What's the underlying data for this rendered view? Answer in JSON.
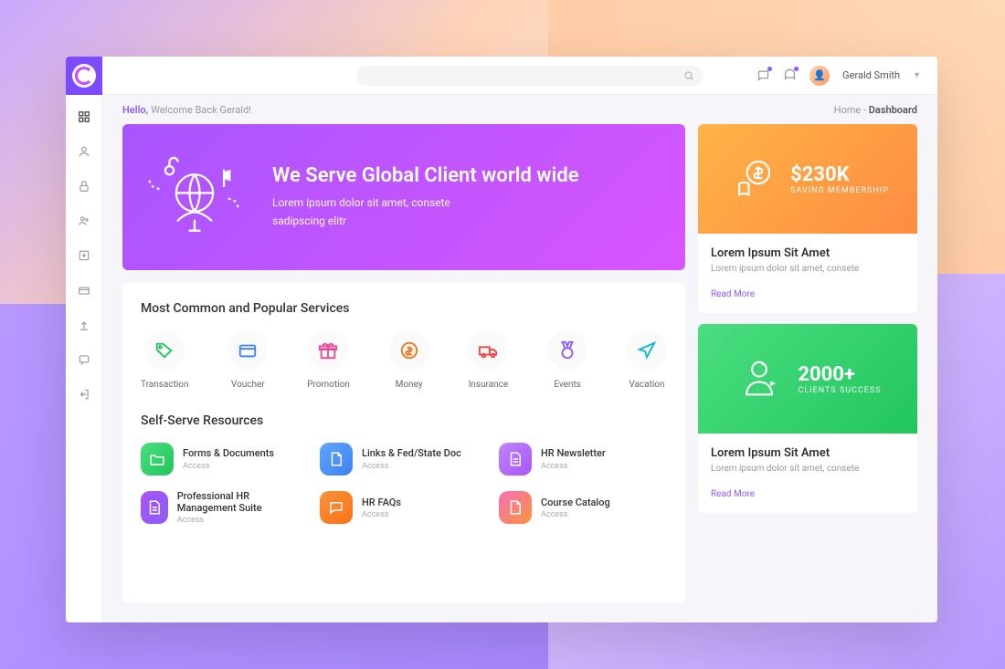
{
  "header": {
    "username": "Gerald Smith",
    "search_placeholder": ""
  },
  "crumb": {
    "hello": "Hello,",
    "welcome": "Welcome Back Gerald!",
    "home": "Home",
    "sep": " - ",
    "current": "Dashboard"
  },
  "hero": {
    "title": "We Serve Global Client world wide",
    "line1": "Lorem ipsum dolor sit amet, consete",
    "line2": "sadipscing elitr"
  },
  "services_title": "Most Common and Popular Services",
  "services": [
    {
      "label": "Transaction",
      "icon": "tag",
      "color": "#22c55e"
    },
    {
      "label": "Voucher",
      "icon": "card",
      "color": "#3b82f6"
    },
    {
      "label": "Promotion",
      "icon": "gift",
      "color": "#ec4899"
    },
    {
      "label": "Money",
      "icon": "money",
      "color": "#f97316"
    },
    {
      "label": "Insurance",
      "icon": "truck",
      "color": "#ef4444"
    },
    {
      "label": "Events",
      "icon": "medal",
      "color": "#8b5cf6"
    },
    {
      "label": "Vacation",
      "icon": "plane",
      "color": "#06b6d4"
    }
  ],
  "resources_title": "Self-Serve Resources",
  "resources": [
    {
      "title": "Forms & Documents",
      "sub": "Access",
      "grad": "linear-gradient(135deg,#4ade80,#22c55e)",
      "icon": "folder"
    },
    {
      "title": "Links & Fed/State Doc",
      "sub": "Access",
      "grad": "linear-gradient(135deg,#60a5fa,#3b82f6)",
      "icon": "doc"
    },
    {
      "title": "HR Newsletter",
      "sub": "Access",
      "grad": "linear-gradient(135deg,#c084fc,#a855f7)",
      "icon": "doc2"
    },
    {
      "title": "Professional HR Management Suite",
      "sub": "Access",
      "grad": "linear-gradient(135deg,#a855f7,#8b5cf6)",
      "icon": "doc2"
    },
    {
      "title": "HR FAQs",
      "sub": "Access",
      "grad": "linear-gradient(135deg,#fb923c,#f97316)",
      "icon": "chat"
    },
    {
      "title": "Course Catalog",
      "sub": "Access",
      "grad": "linear-gradient(135deg,#f472b6,#fb923c)",
      "icon": "doc"
    }
  ],
  "cards": [
    {
      "value": "$230K",
      "sub": "SAVING MEMBERSHIP",
      "title": "Lorem Ipsum Sit Amet",
      "desc": "Lorem ipsum dolor sit amet, consete",
      "link": "Read More",
      "style": "orange",
      "icon": "dollar"
    },
    {
      "value": "2000+",
      "sub": "CLIENTS SUCCESS",
      "title": "Lorem Ipsum Sit Amet",
      "desc": "Lorem ipsum dolor sit amet, consete",
      "link": "Read More",
      "style": "green",
      "icon": "person"
    }
  ]
}
